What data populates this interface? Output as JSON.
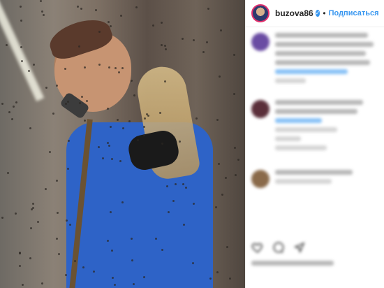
{
  "post": {
    "username": "buzova86",
    "follow_label": "Подписаться",
    "separator": "•"
  },
  "icons": {
    "verified": "verified-badge-icon",
    "like": "heart-icon",
    "comment": "comment-icon",
    "share": "share-icon"
  },
  "colors": {
    "accent": "#3897f0",
    "story_ring": "#e1306c",
    "text": "#262626"
  }
}
